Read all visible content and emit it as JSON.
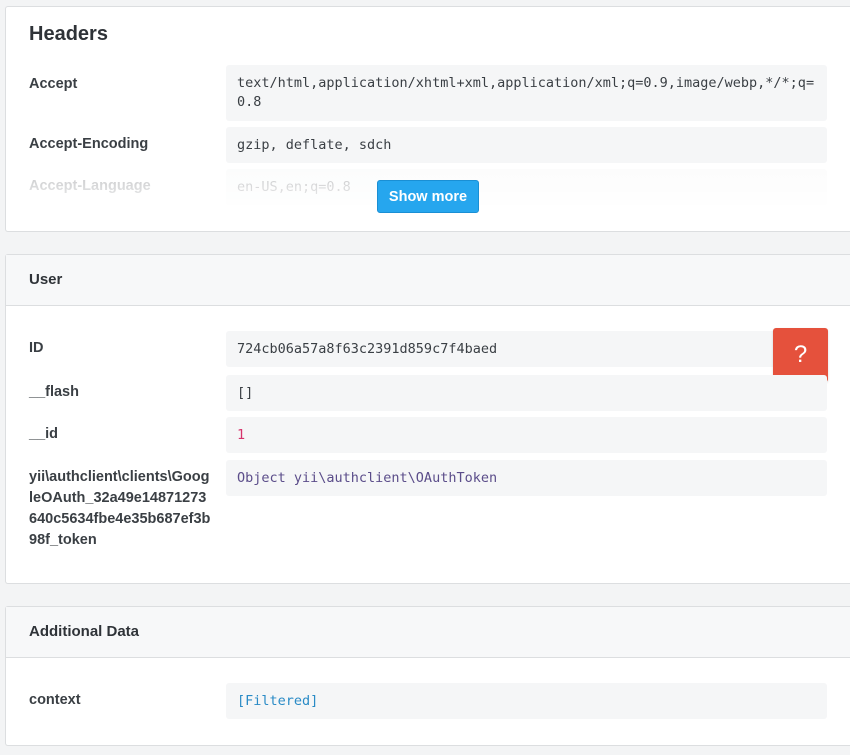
{
  "headers": {
    "title": "Headers",
    "rows": [
      {
        "key": "Accept",
        "value": "text/html,application/xhtml+xml,application/xml;q=0.9,image/webp,*/*;q=0.8"
      },
      {
        "key": "Accept-Encoding",
        "value": "gzip, deflate, sdch"
      },
      {
        "key": "Accept-Language",
        "value": "en-US,en;q=0.8"
      }
    ],
    "show_more_label": "Show more"
  },
  "user": {
    "title": "User",
    "rows": [
      {
        "key": "ID",
        "value": "724cb06a57a8f63c2391d859c7f4baed"
      },
      {
        "key": "__flash",
        "value": "[]"
      },
      {
        "key": "__id",
        "value": "1"
      },
      {
        "key": "yii\\authclient\\clients\\GoogleOAuth_32a49e14871273640c5634fbe4e35b687ef3b98f_token",
        "value": "Object yii\\authclient\\OAuthToken"
      }
    ],
    "help_label": "?"
  },
  "additional": {
    "title": "Additional Data",
    "rows": [
      {
        "key": "context",
        "value": "[Filtered]"
      }
    ]
  },
  "colors": {
    "primary_button": "#26a6ee",
    "help_button": "#e5513c",
    "number_value": "#d6336c",
    "object_value": "#5b4d8a",
    "filtered_value": "#2a8bc6"
  }
}
